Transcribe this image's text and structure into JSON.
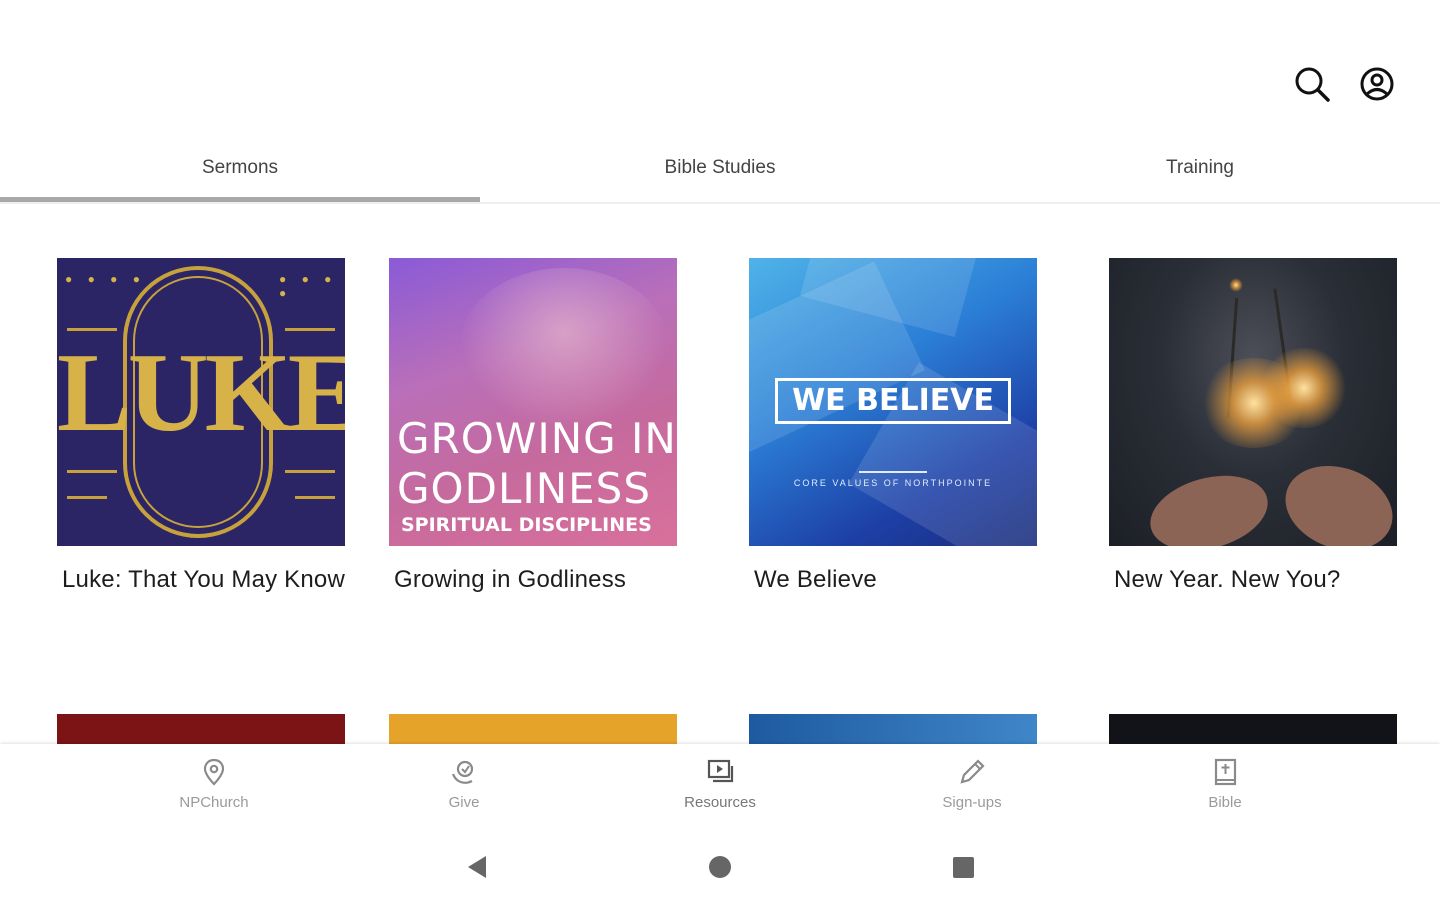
{
  "header": {
    "search_icon": "search-icon",
    "account_icon": "account-circle-icon"
  },
  "tabs": [
    {
      "label": "Sermons",
      "selected": true
    },
    {
      "label": "Bible Studies",
      "selected": false
    },
    {
      "label": "Training",
      "selected": false
    }
  ],
  "cards": [
    {
      "title": "Luke: That You May Know",
      "art_text": "LUKE"
    },
    {
      "title": "Growing in Godliness",
      "art_line1": "GROWING IN",
      "art_line2": "GODLINESS",
      "art_sub": "SPIRITUAL DISCIPLINES"
    },
    {
      "title": "We Believe",
      "art_text": "WE BELIEVE",
      "art_sub": "CORE VALUES OF NORTHPOINTE"
    },
    {
      "title": "New Year. New You?"
    }
  ],
  "bottom_nav": [
    {
      "label": "NPChurch",
      "icon": "location-pin-icon"
    },
    {
      "label": "Give",
      "icon": "give-hand-icon"
    },
    {
      "label": "Resources",
      "icon": "media-library-icon"
    },
    {
      "label": "Sign-ups",
      "icon": "pencil-icon"
    },
    {
      "label": "Bible",
      "icon": "bible-icon"
    }
  ],
  "system_nav": {
    "back": "back-triangle-icon",
    "home": "home-circle-icon",
    "recent": "recents-square-icon"
  },
  "colors": {
    "tab_indicator": "#a8a8a8",
    "nav_label": "#9a9a9a"
  }
}
